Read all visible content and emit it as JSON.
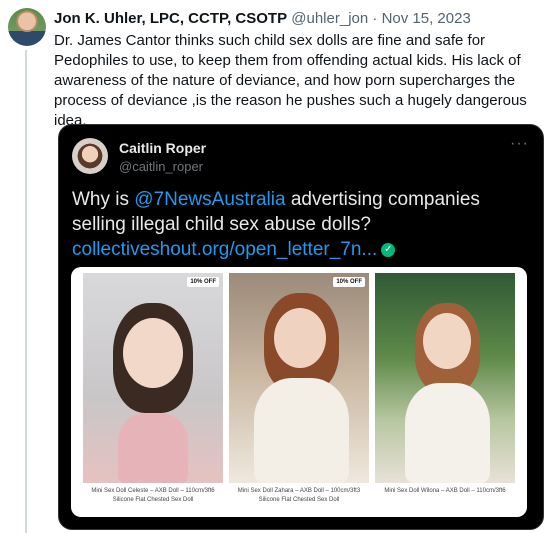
{
  "tweet": {
    "author_name": "Jon K. Uhler, LPC, CCTP, CSOTP",
    "author_handle": "@uhler_jon",
    "separator": "·",
    "date": "Nov 15, 2023",
    "text": "Dr. James Cantor thinks such child sex dolls are fine and safe for Pedophiles to use, to keep them from offending actual kids. His lack of awareness of the nature of deviance, and how porn supercharges the process of deviance ,is the reason he pushes such a hugely dangerous idea."
  },
  "quote": {
    "author_name": "Caitlin Roper",
    "author_handle": "@caitlin_roper",
    "more": "···",
    "text_before": "Why is ",
    "mention": "@7NewsAustralia",
    "text_after": " advertising companies selling illegal child sex abuse dolls?",
    "link": "collectiveshout.org/open_letter_7n...",
    "verified_icon": "✓",
    "products": [
      {
        "badge": "10% OFF",
        "caption": "Mini Sex Doll Celeste – AXB Doll – 110cm/3ft6 Silicone Flat Chested Sex Doll"
      },
      {
        "badge": "10% OFF",
        "caption": "Mini Sex Doll Zahara – AXB Doll – 100cm/3ft3 Silicone Flat Chested Sex Doll"
      },
      {
        "badge": "",
        "caption": "Mini Sex Doll Wilona – AXB Doll – 110cm/3ft6"
      }
    ]
  }
}
